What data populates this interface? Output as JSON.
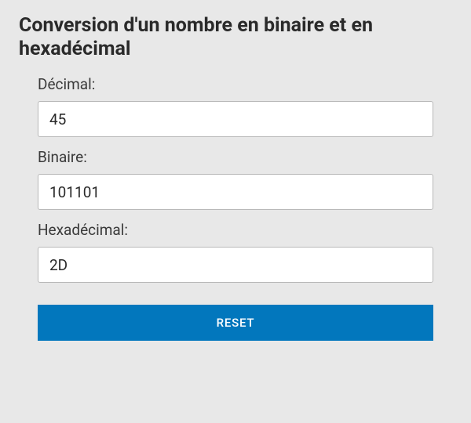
{
  "title": "Conversion d'un nombre en binaire et en hexadécimal",
  "fields": {
    "decimal": {
      "label": "Décimal:",
      "value": "45"
    },
    "binary": {
      "label": "Binaire:",
      "value": "101101"
    },
    "hex": {
      "label": "Hexadécimal:",
      "value": "2D"
    }
  },
  "buttons": {
    "reset": "RESET"
  }
}
